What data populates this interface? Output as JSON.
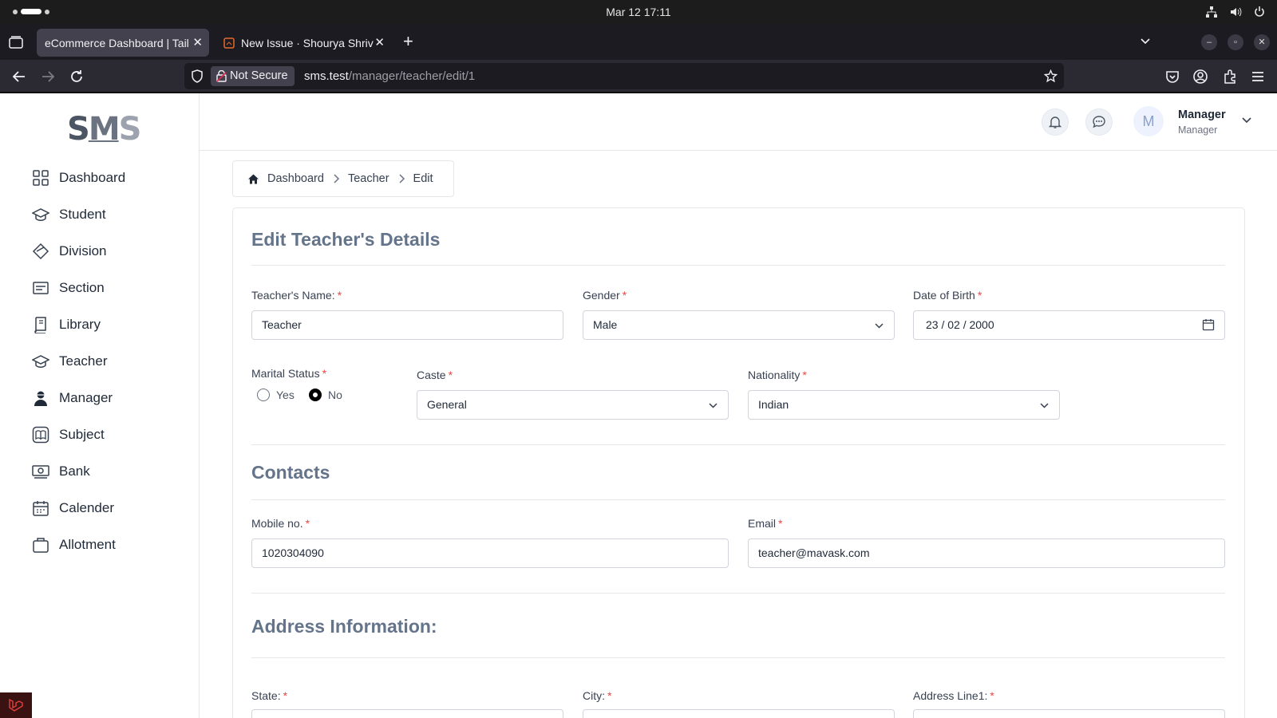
{
  "os": {
    "datetime": "Mar 12  17:11"
  },
  "browser": {
    "tabs": [
      {
        "label": "eCommerce Dashboard | Tail"
      },
      {
        "label": "New Issue · Shourya Shriv"
      }
    ],
    "security_label": "Not Secure",
    "url_host": "sms.test",
    "url_path": "/manager/teacher/edit/1"
  },
  "app": {
    "logo": {
      "s1": "S",
      "m": "M",
      "s2": "S"
    },
    "sidebar": {
      "items": [
        {
          "label": "Dashboard",
          "icon": "grid-icon"
        },
        {
          "label": "Student",
          "icon": "graduation-cap-icon"
        },
        {
          "label": "Division",
          "icon": "diamond-icon"
        },
        {
          "label": "Section",
          "icon": "list-box-icon"
        },
        {
          "label": "Library",
          "icon": "book-icon"
        },
        {
          "label": "Teacher",
          "icon": "graduation-cap-icon"
        },
        {
          "label": "Manager",
          "icon": "user-icon"
        },
        {
          "label": "Subject",
          "icon": "open-book-icon"
        },
        {
          "label": "Bank",
          "icon": "money-icon"
        },
        {
          "label": "Calender",
          "icon": "calendar-icon"
        },
        {
          "label": "Allotment",
          "icon": "briefcase-icon"
        }
      ]
    },
    "header": {
      "avatar_initial": "M",
      "user_name": "Manager",
      "user_role": "Manager"
    },
    "breadcrumb": [
      "Dashboard",
      "Teacher",
      "Edit"
    ]
  },
  "form": {
    "title": "Edit Teacher's Details",
    "name_label": "Teacher's Name:",
    "name_value": "Teacher",
    "gender_label": "Gender",
    "gender_value": "Male",
    "dob_label": "Date of Birth",
    "dob_value": "23 / 02 / 2000",
    "marital_label": "Marital Status",
    "marital_yes": "Yes",
    "marital_no": "No",
    "marital_selected": "No",
    "caste_label": "Caste",
    "caste_value": "General",
    "nationality_label": "Nationality",
    "nationality_value": "Indian",
    "contacts_title": "Contacts",
    "mobile_label": "Mobile no.",
    "mobile_value": "1020304090",
    "email_label": "Email",
    "email_value": "teacher@mavask.com",
    "address_title": "Address Information:",
    "state_label": "State:",
    "city_label": "City:",
    "address1_label": "Address Line1:",
    "required_mark": "*"
  }
}
